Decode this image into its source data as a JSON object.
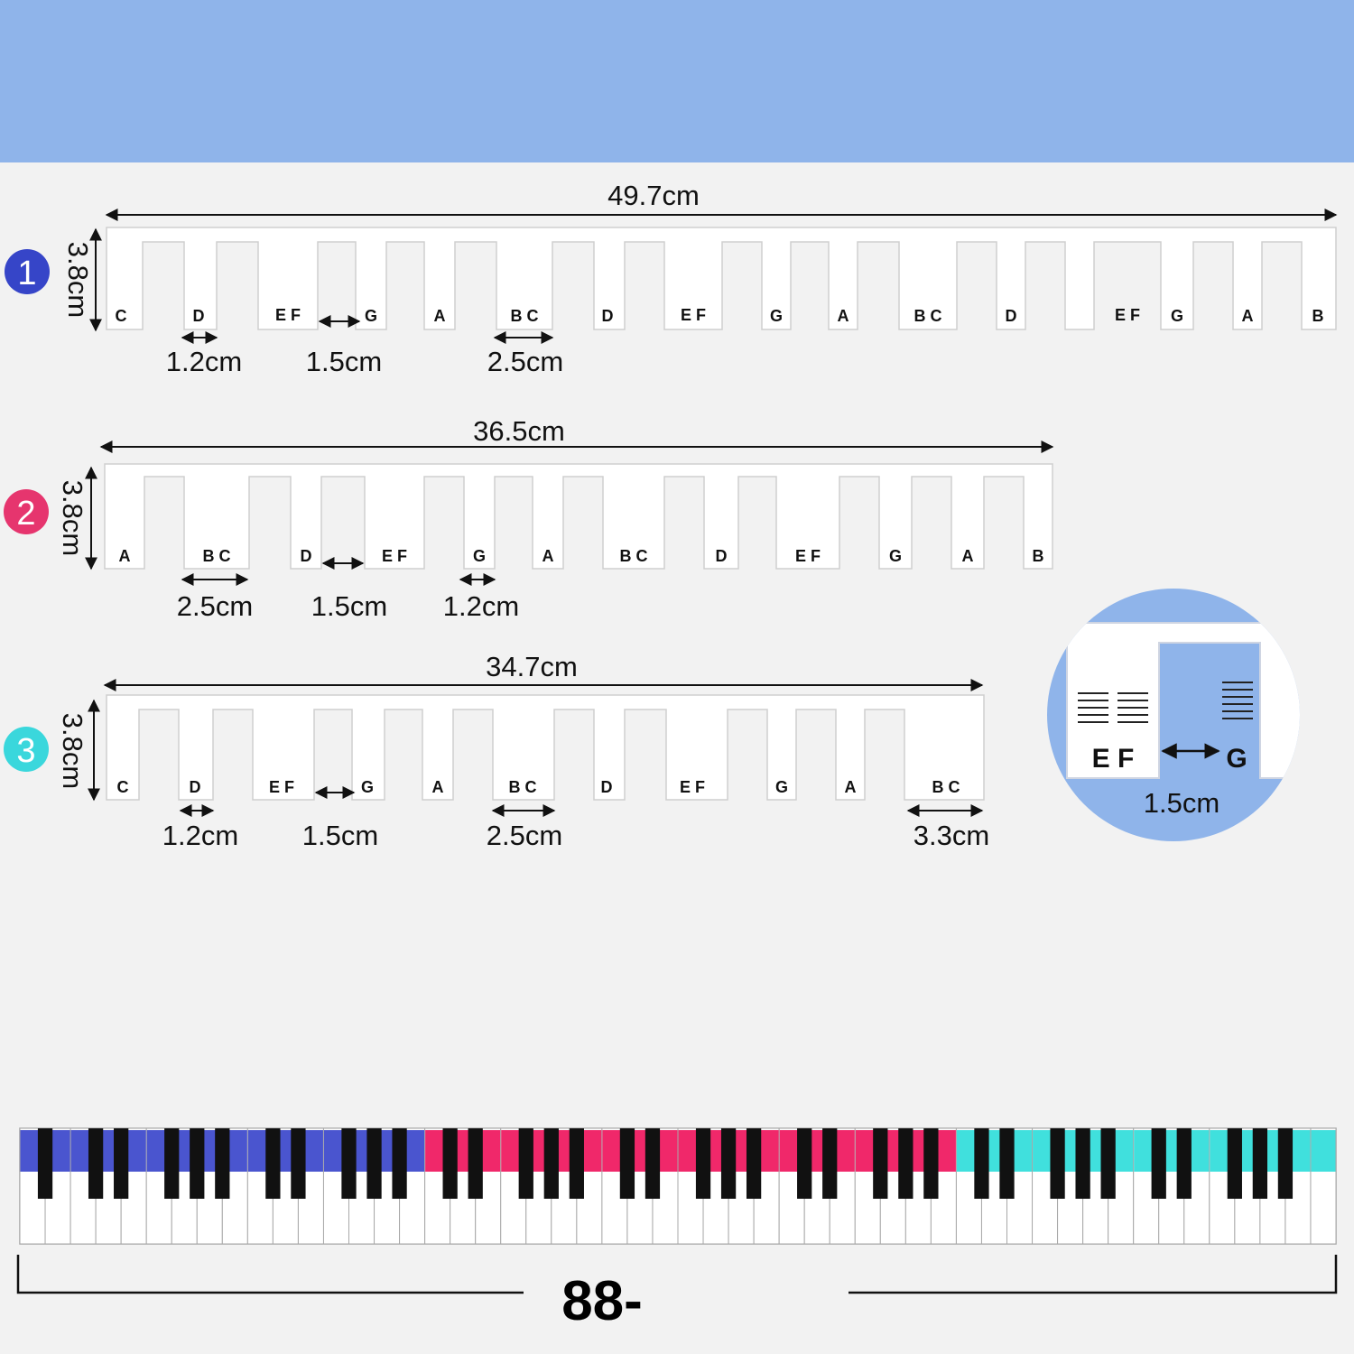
{
  "colors": {
    "banner": "#8fb4ea",
    "background": "#f2f2f2",
    "strip1": "#3645c8",
    "strip2": "#e6356e",
    "strip3": "#3ad7dc",
    "piano_blue": "#4a55cf",
    "piano_pink": "#f0286a",
    "piano_cyan": "#40e0dd",
    "zoom_circle": "#8fb4ea"
  },
  "strips": [
    {
      "badge": "1",
      "length_label": "49.7cm",
      "height_label": "3.8cm",
      "notes": [
        "C",
        "D",
        "E F",
        "G",
        "A",
        "B C",
        "D",
        "E F",
        "G",
        "A",
        "B C",
        "D",
        "E F",
        "G",
        "A",
        "B"
      ],
      "dims": [
        "1.2cm",
        "1.5cm",
        "2.5cm"
      ]
    },
    {
      "badge": "2",
      "length_label": "36.5cm",
      "height_label": "3.8cm",
      "notes": [
        "A",
        "B C",
        "D",
        "E F",
        "G",
        "A",
        "B C",
        "D",
        "E F",
        "G",
        "A",
        "B"
      ],
      "dims": [
        "2.5cm",
        "1.5cm",
        "1.2cm"
      ]
    },
    {
      "badge": "3",
      "length_label": "34.7cm",
      "height_label": "3.8cm",
      "notes": [
        "C",
        "D",
        "E F",
        "G",
        "A",
        "B C",
        "D",
        "E F",
        "G",
        "A",
        "B C"
      ],
      "dims": [
        "1.2cm",
        "1.5cm",
        "2.5cm",
        "3.3cm"
      ]
    }
  ],
  "zoom": {
    "left_notes": "E F",
    "right_note": "G",
    "gap_label": "1.5cm"
  },
  "keyboard": {
    "key_count_label": "88-",
    "white_keys": 52
  }
}
